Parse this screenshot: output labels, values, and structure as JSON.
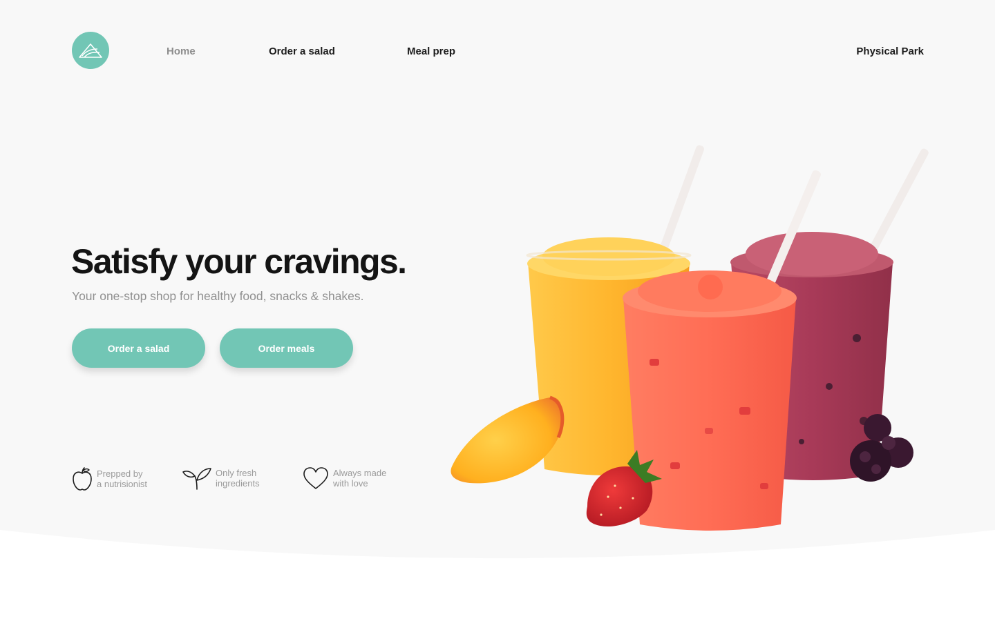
{
  "nav": {
    "logo_icon": "mountain-logo-icon",
    "links": [
      {
        "label": "Home",
        "active": true
      },
      {
        "label": "Order a salad",
        "active": false
      },
      {
        "label": "Meal prep",
        "active": false
      }
    ],
    "location": "Physical Park"
  },
  "hero": {
    "headline": "Satisfy your cravings.",
    "subtitle": "Your one-stop shop for healthy food, snacks & shakes.",
    "primary_button": "Order a salad",
    "secondary_button": "Order meals",
    "image": "three-smoothies-with-fruit"
  },
  "features": [
    {
      "icon": "apple-icon",
      "line1": "Prepped by",
      "line2": "a nutrisionist"
    },
    {
      "icon": "sprout-icon",
      "line1": "Only fresh",
      "line2": "ingredients"
    },
    {
      "icon": "heart-icon",
      "line1": "Always made",
      "line2": "with love"
    }
  ],
  "colors": {
    "accent": "#72c6b5",
    "background": "#f8f8f8",
    "text_dark": "#141414",
    "text_muted": "#909090"
  }
}
